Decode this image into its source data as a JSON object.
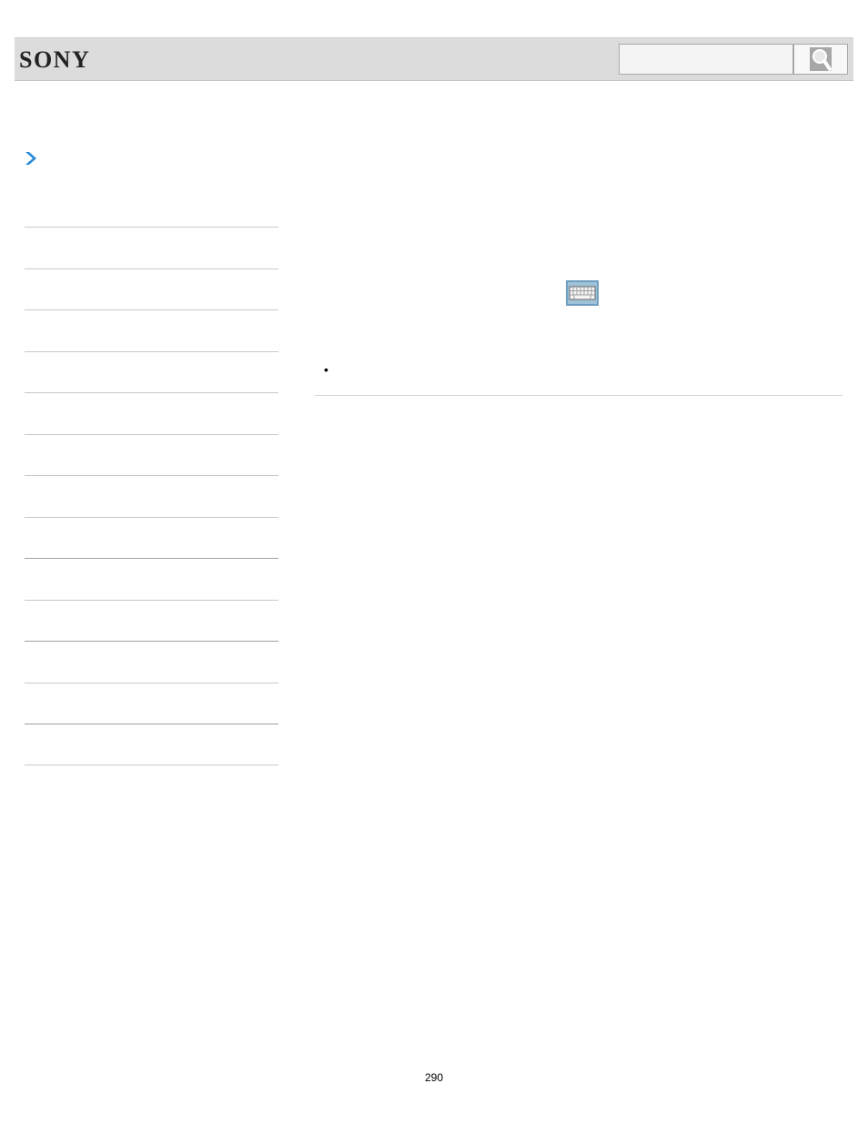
{
  "header": {
    "logo_text": "SONY",
    "search": {
      "value": "",
      "placeholder": ""
    },
    "search_icon": "magnifier-icon"
  },
  "breadcrumb": {
    "icon": "chevron-right-icon",
    "color": "#2b8ad6"
  },
  "sidebar": {
    "items": [
      {
        "label": ""
      },
      {
        "label": ""
      },
      {
        "label": ""
      },
      {
        "label": ""
      },
      {
        "label": ""
      },
      {
        "label": ""
      },
      {
        "label": ""
      },
      {
        "label": ""
      },
      {
        "label": ""
      },
      {
        "label": ""
      },
      {
        "label": ""
      },
      {
        "label": ""
      },
      {
        "label": ""
      }
    ]
  },
  "content": {
    "inline_icon": "keyboard-icon",
    "bullet_symbol": "•"
  },
  "footer": {
    "page_number": "290"
  },
  "colors": {
    "header_bg": "#dcdcdc",
    "accent": "#2b8ad6",
    "keyboard_icon_bg": "#6f9fbf"
  }
}
